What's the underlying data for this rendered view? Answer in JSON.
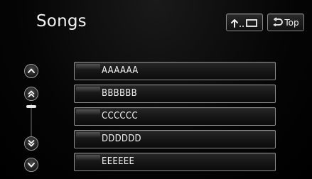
{
  "title": "Songs",
  "header_buttons": {
    "back_to_list": {
      "icon": "back-to-list-icon",
      "label": ""
    },
    "top": {
      "icon": "return-arrow-icon",
      "label": "Top"
    }
  },
  "scroll": {
    "page_up_icon": "chevron-up-icon",
    "fast_up_icon": "double-chevron-up-icon",
    "fast_down_icon": "double-chevron-down-icon",
    "page_down_icon": "chevron-down-icon",
    "position": 0.0
  },
  "songs": [
    "AAAAAA",
    "BBBBBB",
    "CCCCCC",
    "DDDDDD",
    "EEEEEE"
  ],
  "colors": {
    "background": "#000000",
    "text": "#f2f2f2",
    "border": "#8c8c8c"
  }
}
